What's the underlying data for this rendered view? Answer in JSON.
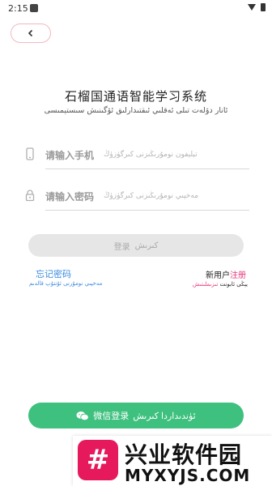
{
  "status_bar": {
    "time": "2:15"
  },
  "page": {
    "title_cn": "石榴国通语智能学习系统",
    "title_ug": "ئانار دۆلەت تىلى ئەقلىي ئىقتىدارلىق ئۆگىنىش سىستېمىسى"
  },
  "form": {
    "phone_label": "请输入手机",
    "phone_sub": "تېلېفون نومۇرىڭىزنى كىرگۈزۈڭ",
    "password_label": "请输入密码",
    "password_sub": "مەخپىي نومۇرىڭىزنى كىرگۈزۈڭ",
    "login_label": "登录",
    "login_sub": "كىرىش"
  },
  "links": {
    "forgot_label": "忘记密码",
    "forgot_sub": "مەخپىي نومۇرنى ئۇنتۇپ قالدىم",
    "new_user": "新用户",
    "register": "注册",
    "register_sub_prefix": "يېڭى ئابونت",
    "register_sub_action": "تىزىملىتىش"
  },
  "wechat": {
    "label": "微信登录",
    "sub": "ئۈندىداردا كىرىش"
  },
  "watermark": {
    "logo_char": "#",
    "title": "兴业软件园",
    "url": "MYXYJS.COM"
  },
  "colors": {
    "accent_blue": "#3a8be0",
    "accent_pink": "#e8357a",
    "wechat_green": "#3ec07e",
    "back_border": "#f3b7bf"
  },
  "icons": [
    "chevron-left-icon",
    "phone-icon",
    "lock-icon",
    "wechat-icon"
  ]
}
